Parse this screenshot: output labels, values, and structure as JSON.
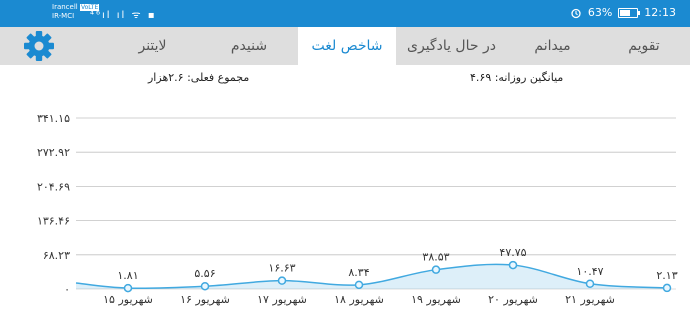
{
  "status_bar": {
    "carrier_top": "Irancell",
    "carrier_badge": "VoLTE",
    "carrier_bottom": "IR-MCI",
    "indicators": "⁴⁶ıl ıl ᯤ ▪",
    "alarm_icon": "alarm-icon",
    "battery_percent": "63%",
    "battery_level": 0.63,
    "time": "12:13"
  },
  "tabs": [
    {
      "label": "تقویم",
      "active": false
    },
    {
      "label": "میدانم",
      "active": false
    },
    {
      "label": "در حال یادگیری",
      "active": false
    },
    {
      "label": "شاخص لغت",
      "active": true
    },
    {
      "label": "شنیدم",
      "active": false
    },
    {
      "label": "لایتنر",
      "active": false
    }
  ],
  "settings_icon": "gear-icon",
  "stats": {
    "total": "مجموع فعلی: ۲.۶هزار",
    "daily_avg": "میانگین روزانه: ۴.۶۹"
  },
  "colors": {
    "accent": "#1b8ad1",
    "line": "#41a9e0",
    "tab_bg": "#dedede"
  },
  "chart_data": {
    "type": "area",
    "categories": [
      "۱۵ شهریور",
      "۱۶ شهریور",
      "۱۷ شهریور",
      "۱۸ شهریور",
      "۱۹ شهریور",
      "۲۰ شهریور",
      "۲۱ شهریور"
    ],
    "y_tick_labels": [
      "۰",
      "۶۸.۲۳",
      "۱۳۶.۴۶",
      "۲۰۴.۶۹",
      "۲۷۲.۹۲",
      "۳۴۱.۱۵"
    ],
    "y_ticks": [
      0,
      68.23,
      136.46,
      204.69,
      272.92,
      341.15
    ],
    "ylim": [
      0,
      341.15
    ],
    "points": [
      {
        "x": "۱۵ شهریور",
        "y": 1.81,
        "label": "۱.۸۱"
      },
      {
        "x": "۱۶ شهریور",
        "y": 5.56,
        "label": "۵.۵۶"
      },
      {
        "x": "۱۷ شهریور",
        "y": 16.63,
        "label": "۱۶.۶۳"
      },
      {
        "x": "۱۸ شهریور",
        "y": 8.34,
        "label": "۸.۳۴"
      },
      {
        "x": "۱۹ شهریور",
        "y": 38.53,
        "label": "۳۸.۵۳"
      },
      {
        "x": "۲۰ شهریور",
        "y": 47.75,
        "label": "۴۷.۷۵"
      },
      {
        "x": "۲۱ شهریور",
        "y": 10.47,
        "label": "۱۰.۴۷"
      },
      {
        "x": "",
        "y": 2.13,
        "label": "۲.۱۳"
      }
    ],
    "grid": true,
    "legend": "none"
  }
}
